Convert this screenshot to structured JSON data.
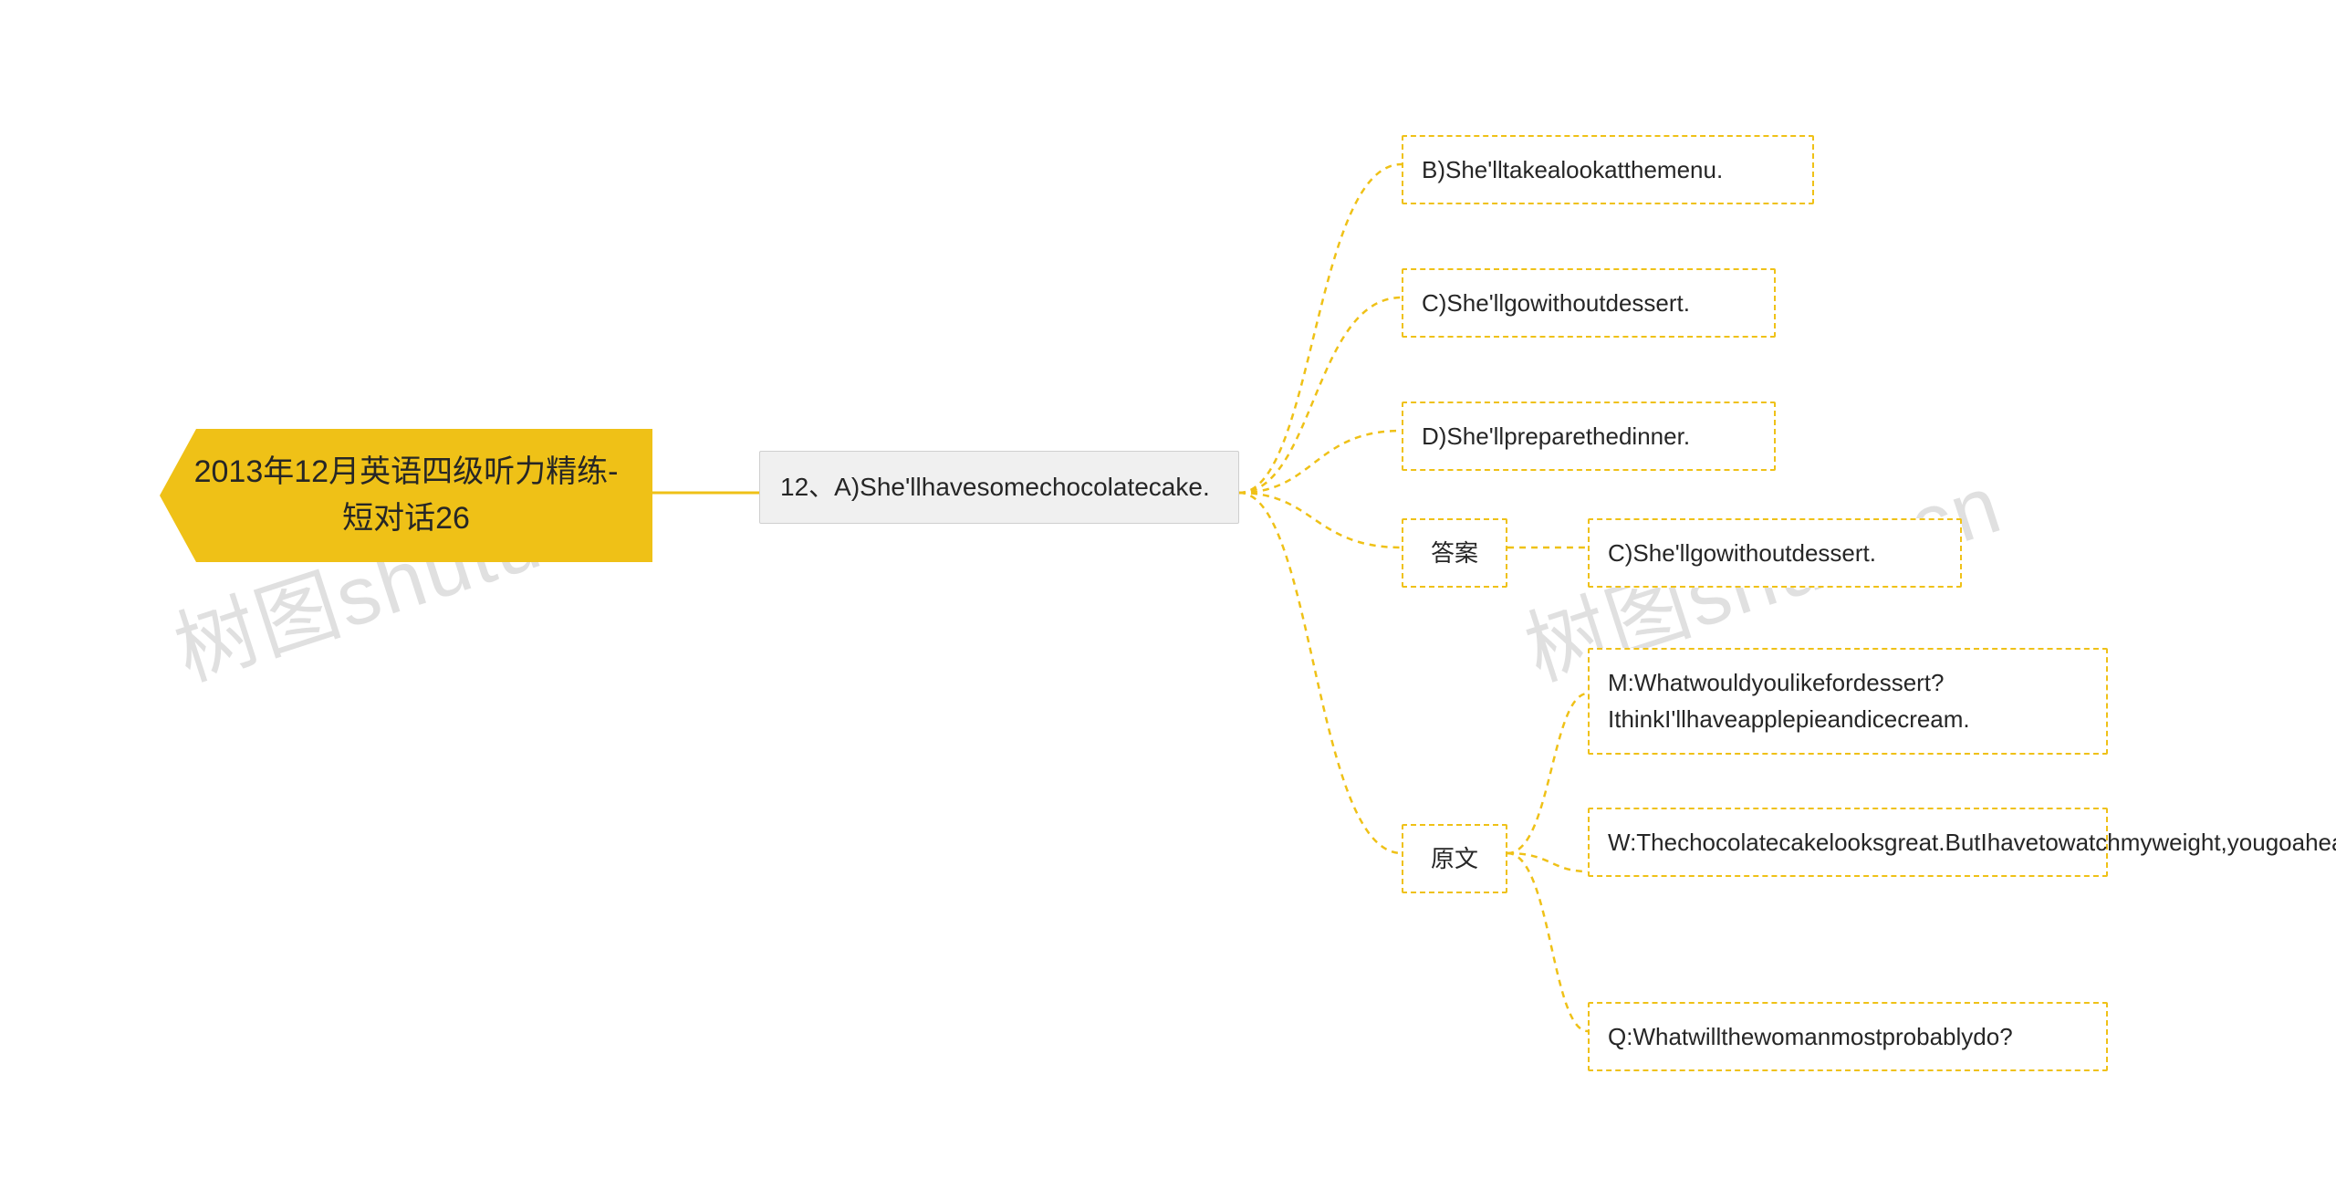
{
  "root": {
    "title": "2013年12月英语四级听力精练-短对话26"
  },
  "question": {
    "label": "12、A)She'llhavesomechocolatecake."
  },
  "options": {
    "b": "B)She'lltakealookatthemenu.",
    "c": "C)She'llgowithoutdessert.",
    "d": "D)She'llpreparethedinner."
  },
  "answer": {
    "label": "答案",
    "value": "C)She'llgowithoutdessert."
  },
  "transcript": {
    "label": "原文",
    "m": "M:Whatwouldyoulikefordessert?IthinkI'llhaveapplepieandicecream.",
    "w": "W:Thechocolatecakelooksgreat.ButIhavetowatchmyweight,yougoaheadandgetyours.",
    "q": "Q:Whatwillthewomanmostprobablydo?"
  },
  "watermark": {
    "text1": "树图shutu.cn",
    "text2": "树图shutu.cn"
  }
}
